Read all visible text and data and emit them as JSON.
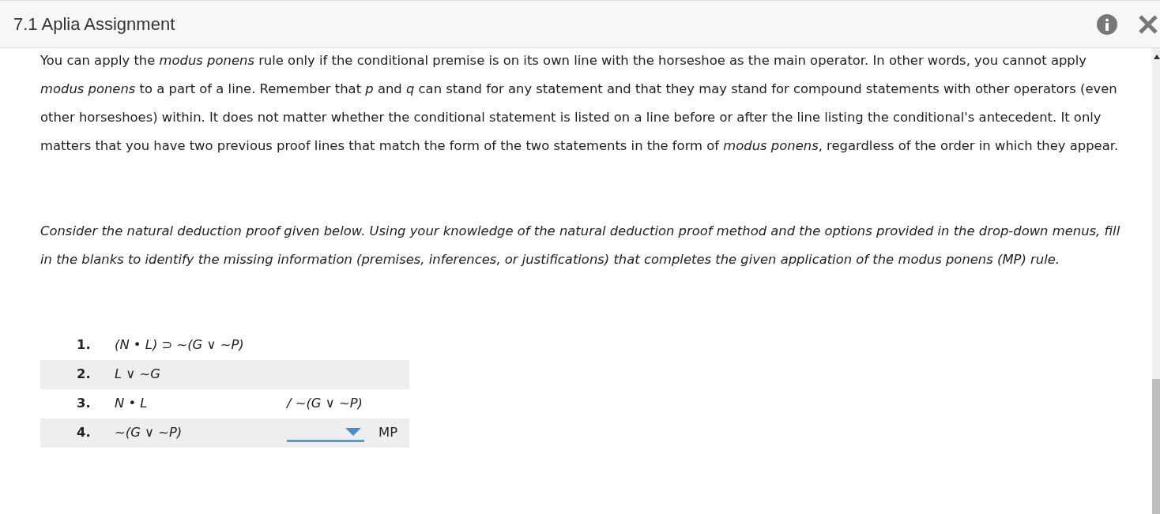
{
  "header": {
    "title": "7.1 Aplia Assignment"
  },
  "explanation": "You can apply the *modus ponens* rule only if the conditional premise is on its own line with the horseshoe as the main operator. In other words, you cannot apply *modus ponens* to a part of a line. Remember that *p* and *q* can stand for any statement and that they may stand for compound statements with other operators (even other horseshoes) within. It does not matter whether the conditional statement is listed on a line before or after the line listing the conditional's antecedent. It only matters that you have two previous proof lines that match the form of the two statements in the form of *modus ponens*, regardless of the order in which they appear.",
  "instructions": "Consider the natural deduction proof given below. Using your knowledge of the natural deduction proof method and the options provided in the drop-down menus, fill in the blanks to identify the missing information (premises, inferences, or justifications) that completes the given application of the modus ponens (MP) rule.",
  "proof": [
    {
      "number": "1.",
      "statement": "(N • L) ⊃ ~(G ∨ ~P)",
      "kind": "premise"
    },
    {
      "number": "2.",
      "statement": "L ∨ ~G",
      "kind": "premise"
    },
    {
      "number": "3.",
      "statement": "N • L",
      "kind": "conclusion",
      "conclusion": "/ ~(G ∨ ~P)"
    },
    {
      "number": "4.",
      "statement": "~(G ∨ ~P)",
      "kind": "blank",
      "rule": "MP"
    }
  ]
}
